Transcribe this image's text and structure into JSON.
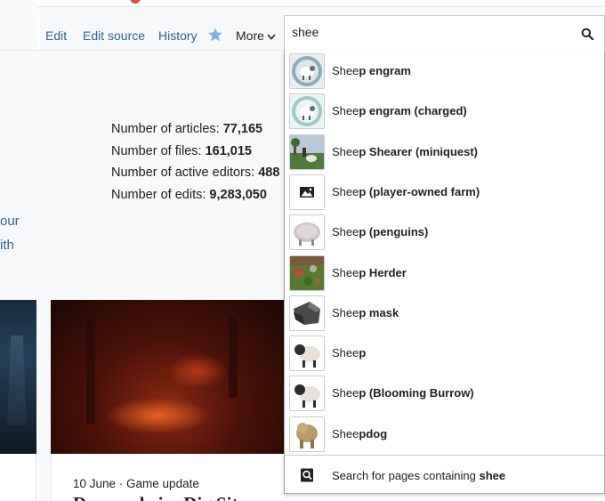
{
  "tabs": {
    "edit": "Edit",
    "edit_source": "Edit source",
    "history": "History",
    "more": "More"
  },
  "search": {
    "value": "shee",
    "placeholder": ""
  },
  "stats": [
    {
      "label": "Number of articles: ",
      "value": "77,165"
    },
    {
      "label": "Number of files: ",
      "value": "161,015"
    },
    {
      "label": "Number of active editors: ",
      "value": "488"
    },
    {
      "label": "Number of edits: ",
      "value": "9,283,050"
    }
  ],
  "left_links": [
    "our",
    "ith"
  ],
  "suggestions": [
    {
      "match": "Shee",
      "rest": "p engram",
      "thumb": "engram"
    },
    {
      "match": "Shee",
      "rest": "p engram (charged)",
      "thumb": "engram-charged"
    },
    {
      "match": "Shee",
      "rest": "p Shearer (miniquest)",
      "thumb": "farm-scene"
    },
    {
      "match": "Shee",
      "rest": "p (player-owned farm)",
      "thumb": "image-placeholder"
    },
    {
      "match": "Shee",
      "rest": "p (penguins)",
      "thumb": "penguin-sheep"
    },
    {
      "match": "Shee",
      "rest": "p Herder",
      "thumb": "herder-scene"
    },
    {
      "match": "Shee",
      "rest": "p mask",
      "thumb": "mask"
    },
    {
      "match": "Shee",
      "rest": "p",
      "thumb": "sheep"
    },
    {
      "match": "Shee",
      "rest": "p (Blooming Burrow)",
      "thumb": "sheep"
    },
    {
      "match": "Shee",
      "rest": "pdog",
      "thumb": "sheepdog"
    }
  ],
  "footer": {
    "prefix": "Search for pages containing ",
    "query": "shee"
  },
  "news": {
    "date": "10 June · Game update",
    "title": "Daemonheim Dig Site"
  },
  "colors": {
    "link": "#2a6595",
    "accent_star": "#7eb3e8",
    "border": "#a2a9b1"
  }
}
